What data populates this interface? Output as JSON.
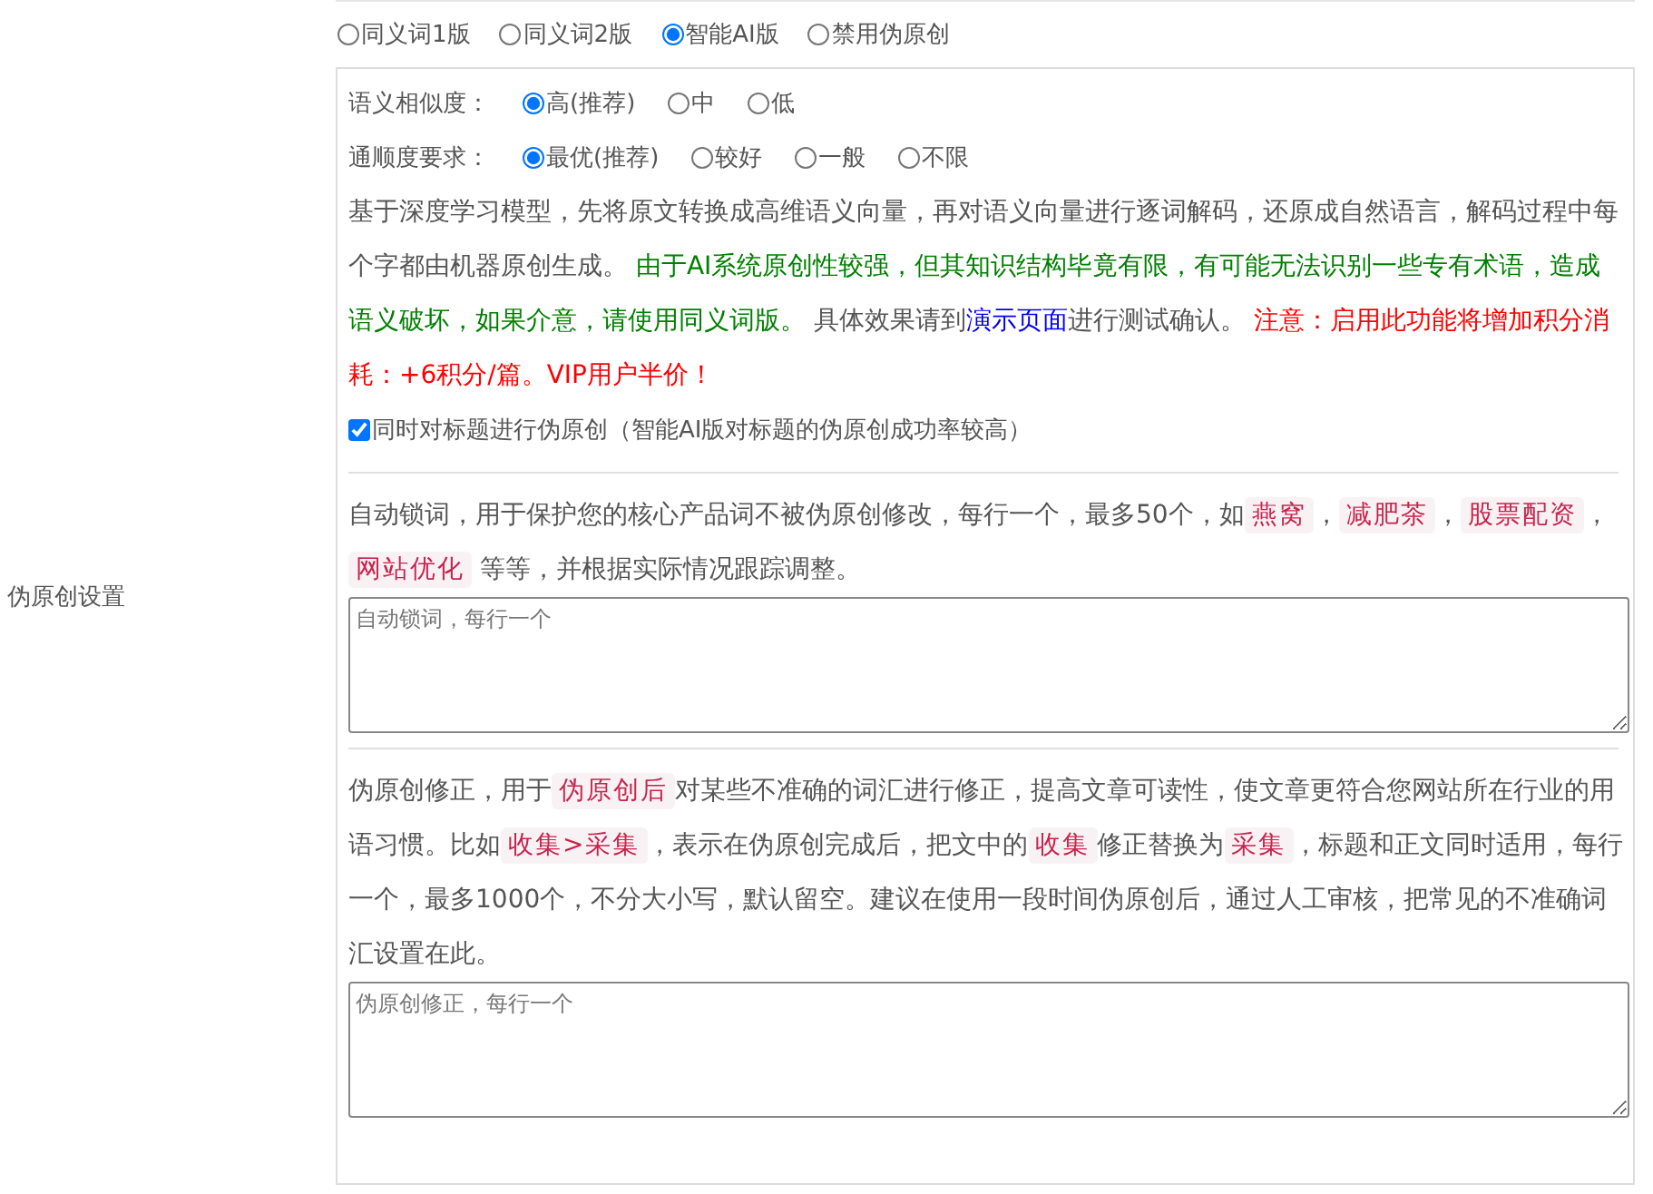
{
  "mode_options": [
    {
      "label": "同义词1版",
      "selected": false
    },
    {
      "label": "同义词2版",
      "selected": false
    },
    {
      "label": "智能AI版",
      "selected": true
    },
    {
      "label": "禁用伪原创",
      "selected": false
    }
  ],
  "settings_label": "伪原创设置",
  "similarity": {
    "label": "语义相似度：",
    "options": [
      {
        "label": "高(推荐)",
        "selected": true
      },
      {
        "label": "中",
        "selected": false
      },
      {
        "label": "低",
        "selected": false
      }
    ]
  },
  "fluency": {
    "label": "通顺度要求：",
    "options": [
      {
        "label": "最优(推荐)",
        "selected": true
      },
      {
        "label": "较好",
        "selected": false
      },
      {
        "label": "一般",
        "selected": false
      },
      {
        "label": "不限",
        "selected": false
      }
    ]
  },
  "ai_description": [
    {
      "kind": "plain",
      "text": "基于深度学习模型，先将原文转换成高维语义向量，再对语义向量进行逐词解码，还原成自然语言，解码过程中每个字都由机器原创生成。 "
    },
    {
      "kind": "green",
      "text": "由于AI系统原创性较强，但其知识结构毕竟有限，有可能无法识别一些专有术语，造成语义破坏，如果介意，请使用同义词版。"
    },
    {
      "kind": "plain",
      "text": " 具体效果请到"
    },
    {
      "kind": "link",
      "text": "演示页面"
    },
    {
      "kind": "plain",
      "text": "进行测试确认。 "
    },
    {
      "kind": "red",
      "text": "注意：启用此功能将增加积分消耗：+6积分/篇。VIP用户半价！"
    }
  ],
  "title_checkbox": {
    "label": "同时对标题进行伪原创（智能AI版对标题的伪原创成功率较高）",
    "checked": true
  },
  "lock_description": [
    {
      "kind": "plain",
      "text": "自动锁词，用于保护您的核心产品词不被伪原创修改，每行一个，最多50个，如"
    },
    {
      "kind": "code",
      "text": "燕窝"
    },
    {
      "kind": "plain",
      "text": "，"
    },
    {
      "kind": "code",
      "text": "减肥茶"
    },
    {
      "kind": "plain",
      "text": "，"
    },
    {
      "kind": "code",
      "text": "股票配资"
    },
    {
      "kind": "plain",
      "text": "，"
    },
    {
      "kind": "code",
      "text": "网站优化"
    },
    {
      "kind": "plain",
      "text": " 等等，并根据实际情况跟踪调整。"
    }
  ],
  "lock_field": {
    "placeholder": "自动锁词，每行一个"
  },
  "fix_description": [
    {
      "kind": "plain",
      "text": "伪原创修正，用于"
    },
    {
      "kind": "code",
      "text": "伪原创后"
    },
    {
      "kind": "plain",
      "text": "对某些不准确的词汇进行修正，提高文章可读性，使文章更符合您网站所在行业的用语习惯。比如"
    },
    {
      "kind": "code",
      "text": "收集>采集"
    },
    {
      "kind": "plain",
      "text": "，表示在伪原创完成后，把文中的"
    },
    {
      "kind": "code",
      "text": "收集"
    },
    {
      "kind": "plain",
      "text": "修正替换为"
    },
    {
      "kind": "code",
      "text": "采集"
    },
    {
      "kind": "plain",
      "text": "，标题和正文同时适用，每行一个，最多1000个，不分大小写，默认留空。建议在使用一段时间伪原创后，通过人工审核，把常见的不准确词汇设置在此。"
    }
  ],
  "fix_field": {
    "placeholder": "伪原创修正，每行一个"
  }
}
